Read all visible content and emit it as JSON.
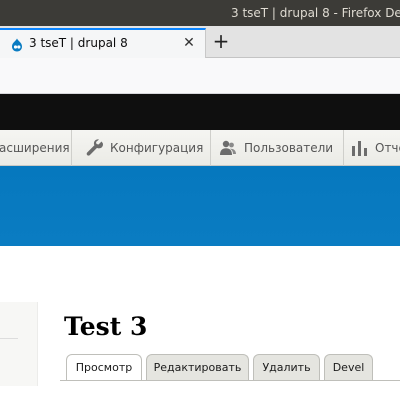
{
  "window": {
    "title": "3 tseT | drupal 8 - Firefox Deve"
  },
  "browser": {
    "tab_title": "3 tseT | drupal 8",
    "close_glyph": "✕",
    "new_tab_glyph": "+"
  },
  "toolbar": {
    "items": [
      {
        "label": "асширения",
        "icon": "extend-icon"
      },
      {
        "label": "Конфигурация",
        "icon": "wrench-icon"
      },
      {
        "label": "Пользователи",
        "icon": "people-icon"
      },
      {
        "label": "Отче",
        "icon": "bar-chart-icon"
      }
    ]
  },
  "page": {
    "title": "Test 3",
    "tabs": [
      {
        "label": "Просмотр",
        "active": true
      },
      {
        "label": "Редактировать",
        "active": false
      },
      {
        "label": "Удалить",
        "active": false
      },
      {
        "label": "Devel",
        "active": false
      }
    ]
  },
  "colors": {
    "header_blue": "#0678be",
    "admin_bar": "#0f0f0f",
    "tab_accent": "#0a84ff"
  }
}
